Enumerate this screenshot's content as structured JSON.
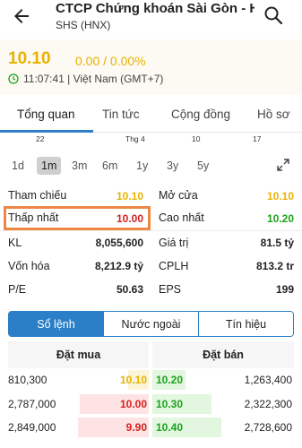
{
  "header": {
    "title": "CTCP Chứng khoán Sài Gòn - Hà...",
    "subtitle": "SHS (HNX)"
  },
  "price": {
    "last": "10.10",
    "change": "0.00 / 0.00%",
    "time": "11:07:41 | Việt Nam (GMT+7)",
    "color": "#e8b300"
  },
  "tabs": [
    "Tổng quan",
    "Tin tức",
    "Cộng đồng",
    "Hồ sơ"
  ],
  "axis_labels": [
    "22",
    "Thg 4",
    "10",
    "17"
  ],
  "ranges": [
    "1d",
    "1m",
    "3m",
    "6m",
    "1y",
    "3y",
    "5y"
  ],
  "active_range": "1m",
  "stats": {
    "tham_chieu": {
      "label": "Tham chiếu",
      "value": "10.10"
    },
    "mo_cua": {
      "label": "Mở cửa",
      "value": "10.10"
    },
    "thap_nhat": {
      "label": "Thấp nhất",
      "value": "10.00"
    },
    "cao_nhat": {
      "label": "Cao nhất",
      "value": "10.20"
    },
    "kl": {
      "label": "KL",
      "value": "8,055,600"
    },
    "gia_tri": {
      "label": "Giá trị",
      "value": "81.5 tỷ"
    },
    "von_hoa": {
      "label": "Vốn hóa",
      "value": "8,212.9 tỷ"
    },
    "cplh": {
      "label": "CPLH",
      "value": "813.2 tr"
    },
    "pe": {
      "label": "P/E",
      "value": "50.63"
    },
    "eps": {
      "label": "EPS",
      "value": "199"
    }
  },
  "segments": [
    "Sổ lệnh",
    "Nước ngoài",
    "Tín hiệu"
  ],
  "orderbook": {
    "buy_header": "Đặt mua",
    "sell_header": "Đặt bán",
    "rows": [
      {
        "buy_vol": "810,300",
        "buy_price": "10.10",
        "sell_price": "10.20",
        "sell_vol": "1,263,400"
      },
      {
        "buy_vol": "2,787,000",
        "buy_price": "10.00",
        "sell_price": "10.30",
        "sell_vol": "2,322,300"
      },
      {
        "buy_vol": "2,849,000",
        "buy_price": "9.90",
        "sell_price": "10.40",
        "sell_vol": "2,728,600"
      }
    ]
  },
  "colors": {
    "accent": "#2a7fc6",
    "up": "#1aa31a",
    "down": "#d32020",
    "ref": "#e8b300",
    "highlight_box": "#ee8745"
  }
}
